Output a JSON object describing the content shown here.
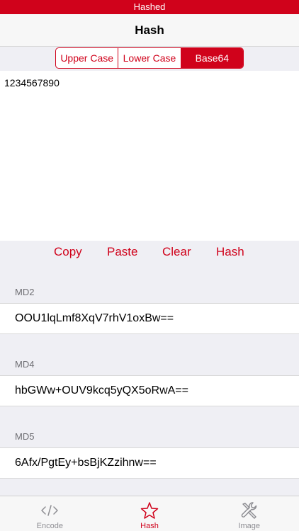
{
  "status_bar": {
    "title": "Hashed"
  },
  "nav": {
    "title": "Hash"
  },
  "segments": [
    {
      "label": "Upper Case",
      "active": false
    },
    {
      "label": "Lower Case",
      "active": false
    },
    {
      "label": "Base64",
      "active": true
    }
  ],
  "input": {
    "value": "1234567890"
  },
  "actions": {
    "copy": "Copy",
    "paste": "Paste",
    "clear": "Clear",
    "hash": "Hash"
  },
  "results": [
    {
      "algorithm": "MD2",
      "value": "OOU1lqLmf8XqV7rhV1oxBw=="
    },
    {
      "algorithm": "MD4",
      "value": "hbGWw+OUV9kcq5yQX5oRwA=="
    },
    {
      "algorithm": "MD5",
      "value": "6Afx/PgtEy+bsBjKZzihnw=="
    }
  ],
  "tabs": [
    {
      "label": "Encode",
      "icon": "code-icon",
      "active": false
    },
    {
      "label": "Hash",
      "icon": "star-icon",
      "active": true
    },
    {
      "label": "Image",
      "icon": "wrench-icon",
      "active": false
    }
  ],
  "colors": {
    "accent": "#d0021b",
    "inactive": "#8e8e93",
    "background": "#efeff4"
  }
}
